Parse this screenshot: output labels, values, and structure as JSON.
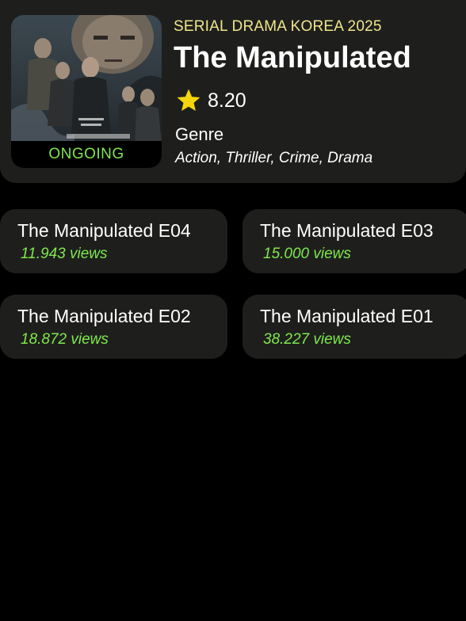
{
  "header": {
    "category": "SERIAL DRAMA KOREA 2025",
    "title": "The Manipulated",
    "rating": "8.20",
    "genre_label": "Genre",
    "genres": "Action, Thriller, Crime, Drama",
    "status": "ONGOING",
    "status_color": "#7fe84a",
    "category_color": "#f0e58a",
    "star_icon": "star-icon"
  },
  "episodes": [
    {
      "title": "The Manipulated E04",
      "views": "11.943 views"
    },
    {
      "title": "The Manipulated E03",
      "views": "15.000 views"
    },
    {
      "title": "The Manipulated E02",
      "views": "18.872 views"
    },
    {
      "title": "The Manipulated E01",
      "views": "38.227 views"
    }
  ]
}
